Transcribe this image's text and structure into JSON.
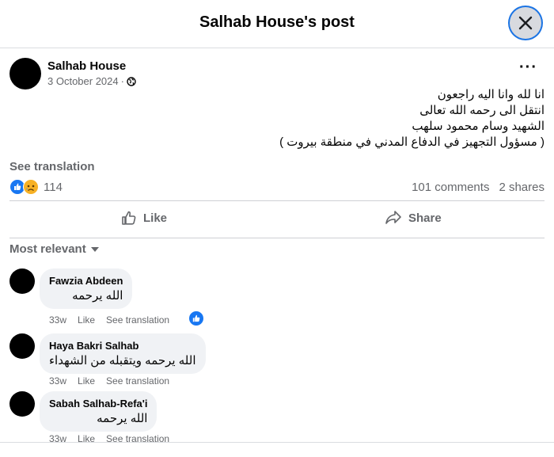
{
  "header": {
    "title": "Salhab House's post"
  },
  "post": {
    "page_name": "Salhab House",
    "date": "3 October 2024",
    "separator": "·",
    "text_lines": [
      "انا لله وانا اليه راجعون",
      "انتقل الى رحمه الله تعالى",
      "الشهيد وسام محمود سلهب",
      "( مسؤول التجهيز في الدفاع المدني في منطقة بيروت )"
    ],
    "see_translation": "See translation",
    "reaction_count": "114",
    "comments_count": "101 comments",
    "shares_count": "2 shares"
  },
  "actions": {
    "like": "Like",
    "share": "Share"
  },
  "sort": {
    "label": "Most relevant"
  },
  "comments": [
    {
      "author": "Fawzia Abdeen",
      "text": "الله يرحمه",
      "time": "33w",
      "like": "Like",
      "translate": "See translation"
    },
    {
      "author": "Haya Bakri Salhab",
      "text": "الله يرحمه ويتقبله من الشهداء",
      "time": "33w",
      "like": "Like",
      "translate": "See translation"
    },
    {
      "author": "Sabah Salhab-Refa'i",
      "text": "الله يرحمه",
      "time": "33w",
      "like": "Like",
      "translate": "See translation"
    }
  ],
  "colors": {
    "accent": "#1877f2",
    "muted": "#65676b",
    "bubble": "#f0f2f5"
  }
}
